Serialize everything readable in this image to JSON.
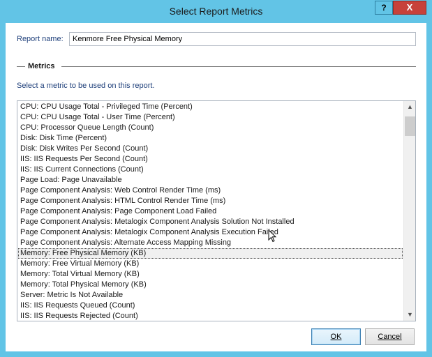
{
  "window": {
    "title": "Select Report Metrics",
    "help_label": "?",
    "close_label": "X"
  },
  "report": {
    "label": "Report name:",
    "value": "Kenmore Free Physical Memory"
  },
  "metrics": {
    "section_title": "Metrics",
    "hint": "Select a metric to be used on this report.",
    "items": [
      "CPU: CPU Usage Total - Privileged Time (Percent)",
      "CPU: CPU Usage Total - User Time (Percent)",
      "CPU: Processor Queue Length (Count)",
      "Disk: Disk Time (Percent)",
      "Disk: Disk Writes Per Second (Count)",
      "IIS: IIS Requests Per Second (Count)",
      "IIS: IIS Current Connections (Count)",
      "Page Load: Page Unavailable",
      "Page Component Analysis: Web Control Render Time (ms)",
      "Page Component Analysis: HTML Control Render Time (ms)",
      "Page Component Analysis: Page Component Load Failed",
      "Page Component Analysis: Metalogix Component Analysis Solution Not Installed",
      "Page Component Analysis: Metalogix Component Analysis Execution Failed",
      "Page Component Analysis: Alternate Access Mapping Missing",
      "Memory: Free Physical Memory (KB)",
      "Memory: Free Virtual Memory (KB)",
      "Memory: Total Virtual Memory (KB)",
      "Memory: Total Physical Memory (KB)",
      "Server: Metric Is Not Available",
      "IIS: IIS Requests Queued (Count)",
      "IIS: IIS Requests Rejected (Count)"
    ],
    "selected_index": 14
  },
  "buttons": {
    "ok_label": "OK",
    "cancel_label": "Cancel"
  },
  "icons": {
    "scroll_up": "chevron-up-icon",
    "scroll_down": "chevron-down-icon",
    "cursor": "mouse-pointer-icon"
  },
  "colors": {
    "titlebar": "#62c4e6",
    "close": "#c7413a",
    "label_text": "#1e3f7a"
  }
}
